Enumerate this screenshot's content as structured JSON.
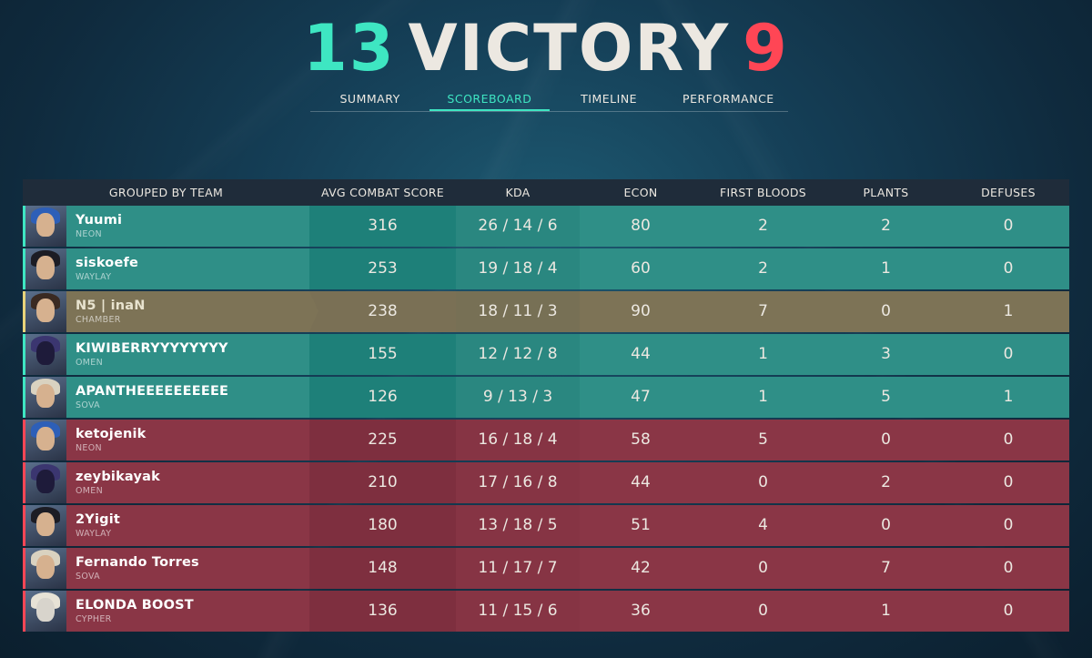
{
  "header": {
    "team_score": "13",
    "result": "VICTORY",
    "enemy_score": "9"
  },
  "tabs": [
    {
      "label": "SUMMARY",
      "active": false
    },
    {
      "label": "SCOREBOARD",
      "active": true
    },
    {
      "label": "TIMELINE",
      "active": false
    },
    {
      "label": "PERFORMANCE",
      "active": false
    }
  ],
  "scoreboard": {
    "columns": [
      "GROUPED BY TEAM",
      "AVG COMBAT SCORE",
      "KDA",
      "ECON",
      "FIRST BLOODS",
      "PLANTS",
      "DEFUSES"
    ],
    "rows": [
      {
        "name": "Yuumi",
        "agent": "NEON",
        "acs": "316",
        "kda": "26 / 14 / 6",
        "econ": "80",
        "fb": "2",
        "plants": "2",
        "defuses": "0",
        "team": "a"
      },
      {
        "name": "siskoefe",
        "agent": "WAYLAY",
        "acs": "253",
        "kda": "19 / 18 / 4",
        "econ": "60",
        "fb": "2",
        "plants": "1",
        "defuses": "0",
        "team": "a"
      },
      {
        "name": "N5 | inaN",
        "agent": "CHAMBER",
        "acs": "238",
        "kda": "18 / 11 / 3",
        "econ": "90",
        "fb": "7",
        "plants": "0",
        "defuses": "1",
        "team": "a"
      },
      {
        "name": "KIWIBERRYYYYYYYY",
        "agent": "OMEN",
        "acs": "155",
        "kda": "12 / 12 / 8",
        "econ": "44",
        "fb": "1",
        "plants": "3",
        "defuses": "0",
        "team": "a"
      },
      {
        "name": "APANTHEEEEEEEEEE",
        "agent": "SOVA",
        "acs": "126",
        "kda": "9 / 13 / 3",
        "econ": "47",
        "fb": "1",
        "plants": "5",
        "defuses": "1",
        "team": "a"
      },
      {
        "name": "ketojenik",
        "agent": "NEON",
        "acs": "225",
        "kda": "16 / 18 / 4",
        "econ": "58",
        "fb": "5",
        "plants": "0",
        "defuses": "0",
        "team": "b"
      },
      {
        "name": "zeybikayak",
        "agent": "OMEN",
        "acs": "210",
        "kda": "17 / 16 / 8",
        "econ": "44",
        "fb": "0",
        "plants": "2",
        "defuses": "0",
        "team": "b"
      },
      {
        "name": "2Yigit",
        "agent": "WAYLAY",
        "acs": "180",
        "kda": "13 / 18 / 5",
        "econ": "51",
        "fb": "4",
        "plants": "0",
        "defuses": "0",
        "team": "b"
      },
      {
        "name": "Fernando Torres",
        "agent": "SOVA",
        "acs": "148",
        "kda": "11 / 17 / 7",
        "econ": "42",
        "fb": "0",
        "plants": "7",
        "defuses": "0",
        "team": "b"
      },
      {
        "name": "ELONDA BOOST",
        "agent": "CYPHER",
        "acs": "136",
        "kda": "11 / 15 / 6",
        "econ": "36",
        "fb": "0",
        "plants": "1",
        "defuses": "0",
        "team": "b"
      }
    ]
  },
  "colors": {
    "team_win": "#3ee6c2",
    "team_loss": "#ff4655",
    "team_a_row": "#2f8f87",
    "team_b_row": "#8a3646",
    "self_row": "#7d7356"
  }
}
